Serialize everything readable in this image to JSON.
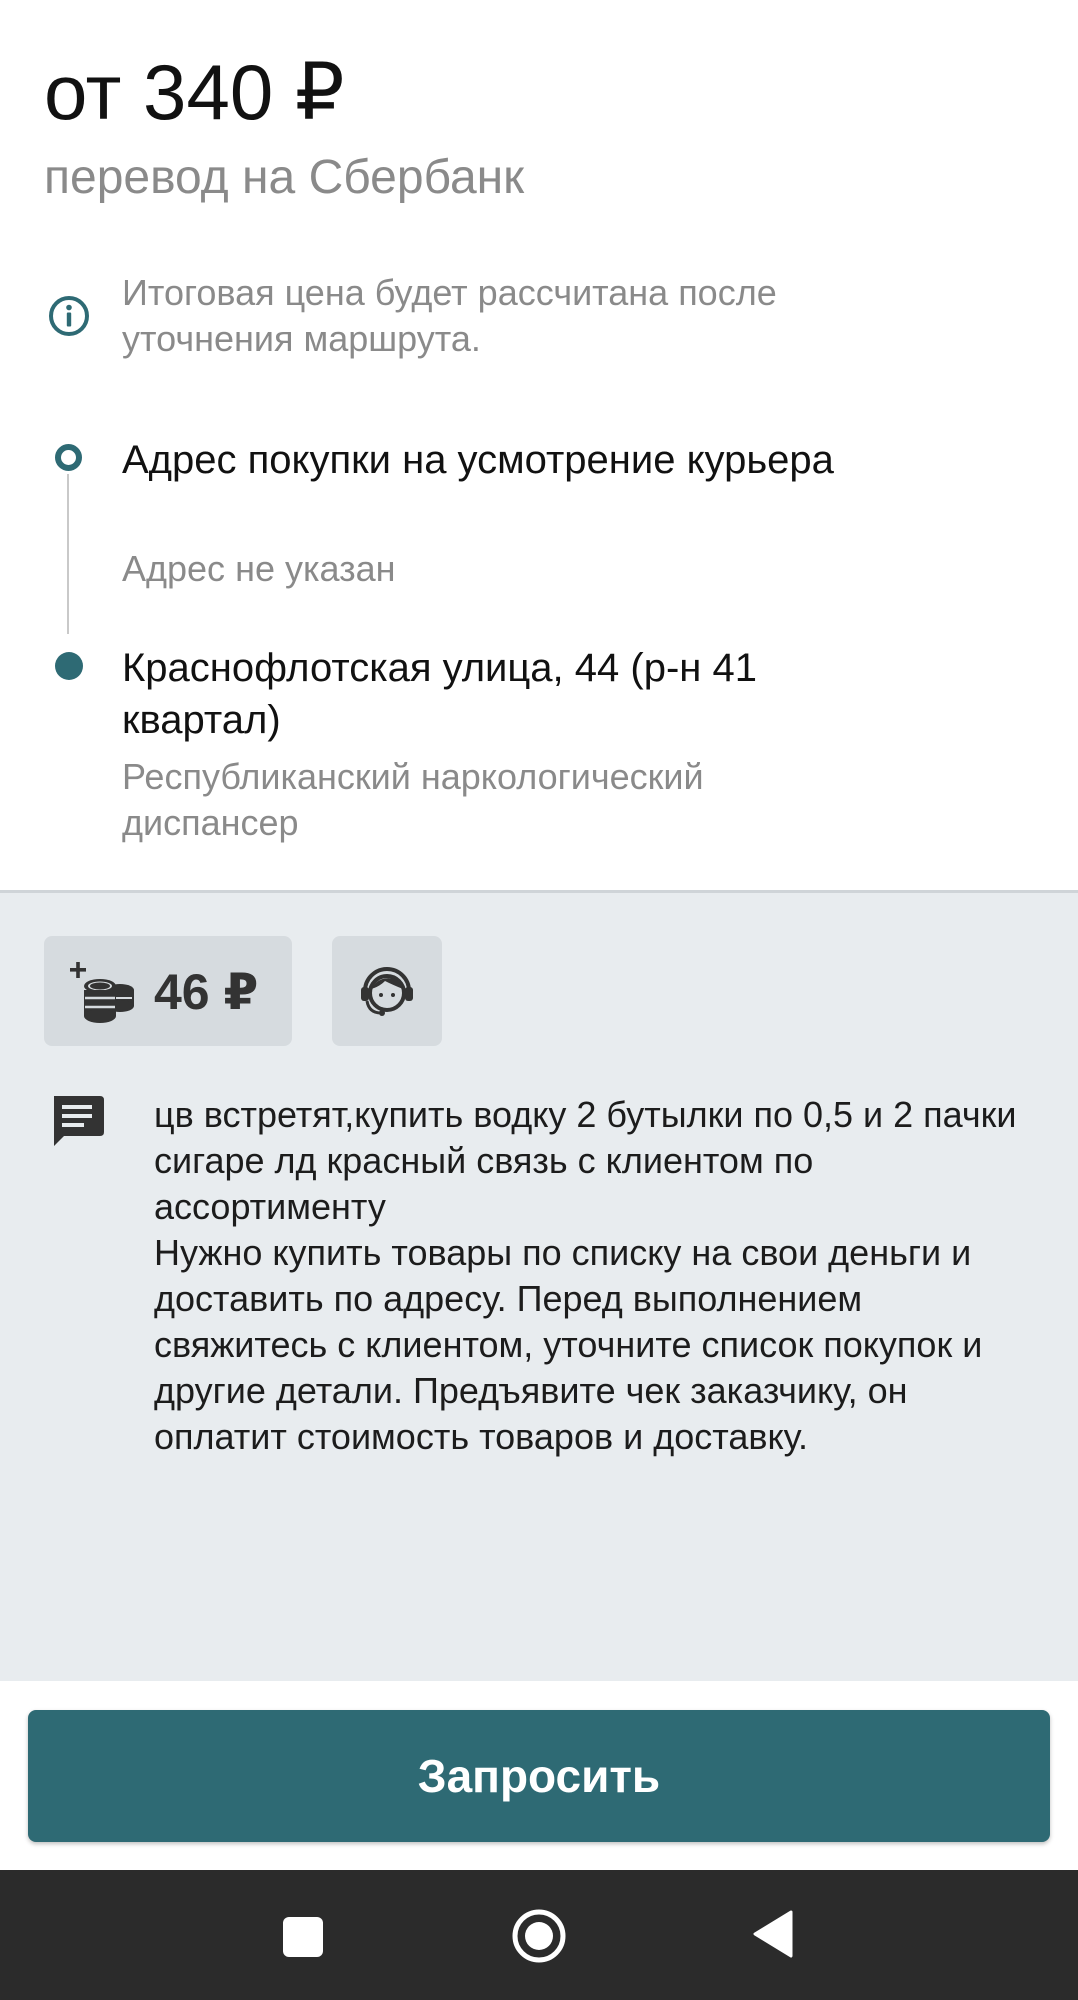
{
  "order": {
    "price": "от 340 ₽",
    "payment_method": "перевод на Сбербанк",
    "price_note": "Итоговая цена будет рассчитана после уточнения маршрута."
  },
  "route": {
    "from": {
      "title": "Адрес покупки на усмотрение курьера",
      "subtitle": "Адрес не указан"
    },
    "to": {
      "title": "Краснофлотская улица, 44 (р-н 41 квартал)",
      "subtitle": "Республиканский наркологический диспансер"
    }
  },
  "extras": {
    "bonus_value": "46 ₽",
    "bonus_icon": "coins-plus-icon",
    "support_icon": "support-agent-icon"
  },
  "comment": {
    "icon": "comment-icon",
    "text": "цв встретят,купить водку 2 бутылки по 0,5 и 2 пачки сигаре лд красный связь с клиентом по ассортименту\nНужно купить товары по списку на свои деньги и доставить по адресу. Перед выполнением свяжитесь с клиентом, уточните список покупок и другие детали. Предъявите чек заказчику, он оплатит стоимость товаров и доставку."
  },
  "actions": {
    "request_label": "Запросить"
  },
  "colors": {
    "accent": "#2e6a74",
    "gray_bg": "#e8ecef",
    "chip_bg": "#d6dbdf",
    "navbar_bg": "#2b2b2b"
  }
}
